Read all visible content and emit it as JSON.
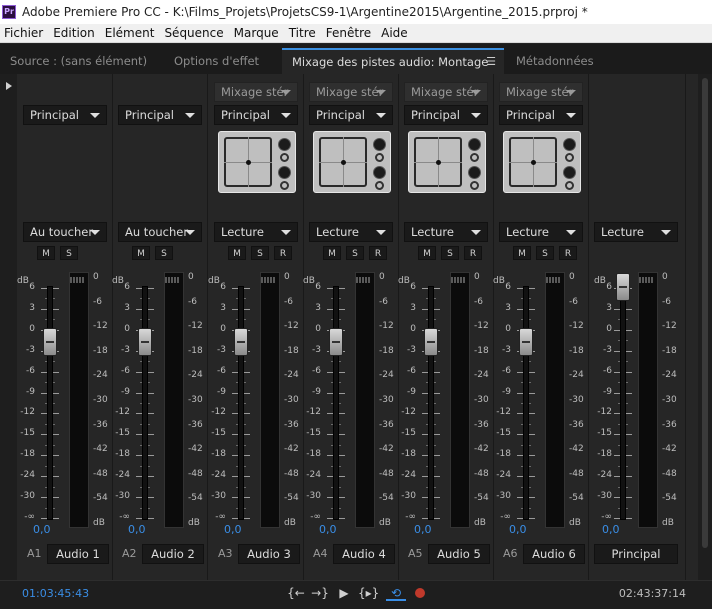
{
  "window": {
    "title": "Adobe Premiere Pro CC - K:\\Films_Projets\\ProjetsCS9-1\\Argentine2015\\Argentine_2015.prproj *",
    "app_icon": "Pr"
  },
  "menu": [
    "Fichier",
    "Edition",
    "Elément",
    "Séquence",
    "Marque",
    "Titre",
    "Fenêtre",
    "Aide"
  ],
  "tabs": [
    {
      "label": "Source : (sans élément)",
      "active": false
    },
    {
      "label": "Options d'effet",
      "active": false
    },
    {
      "label": "Mixage des pistes audio: Montage",
      "active": true
    },
    {
      "label": "Métadonnées",
      "active": false
    }
  ],
  "mixer": {
    "left_scale": [
      "6",
      "3",
      "0",
      "-3",
      "-6",
      "-9",
      "-12",
      "-15",
      "-18",
      "-24",
      "-30",
      "-∞"
    ],
    "meter_scale": [
      "0",
      "-6",
      "-12",
      "-18",
      "-24",
      "-30",
      "-36",
      "-42",
      "-48",
      "-54",
      "dB"
    ],
    "db": "dB",
    "tracks": [
      {
        "id": "A1",
        "name": "Audio 1",
        "submix": "",
        "output": "Principal",
        "automation": "Au toucher",
        "buttons": [
          "M",
          "S"
        ],
        "panner": false,
        "volume": "0,0"
      },
      {
        "id": "A2",
        "name": "Audio 2",
        "submix": "",
        "output": "Principal",
        "automation": "Au toucher",
        "buttons": [
          "M",
          "S"
        ],
        "panner": false,
        "volume": "0,0"
      },
      {
        "id": "A3",
        "name": "Audio 3",
        "submix": "Mixage stér",
        "output": "Principal",
        "automation": "Lecture",
        "buttons": [
          "M",
          "S",
          "R"
        ],
        "panner": true,
        "volume": "0,0"
      },
      {
        "id": "A4",
        "name": "Audio 4",
        "submix": "Mixage stér",
        "output": "Principal",
        "automation": "Lecture",
        "buttons": [
          "M",
          "S",
          "R"
        ],
        "panner": true,
        "volume": "0,0"
      },
      {
        "id": "A5",
        "name": "Audio 5",
        "submix": "Mixage stér",
        "output": "Principal",
        "automation": "Lecture",
        "buttons": [
          "M",
          "S",
          "R"
        ],
        "panner": true,
        "volume": "0,0"
      },
      {
        "id": "A6",
        "name": "Audio 6",
        "submix": "Mixage stér",
        "output": "Principal",
        "automation": "Lecture",
        "buttons": [
          "M",
          "S",
          "R"
        ],
        "panner": true,
        "volume": "0,0"
      }
    ],
    "master": {
      "name": "Principal",
      "automation": "Lecture",
      "volume": "0,0"
    }
  },
  "transport": {
    "current_time": "01:03:45:43",
    "duration": "02:43:37:14",
    "buttons": [
      "go-to-in-icon",
      "go-to-out-icon",
      "play-icon",
      "play-in-to-out-icon",
      "loop-icon",
      "record-icon"
    ]
  }
}
